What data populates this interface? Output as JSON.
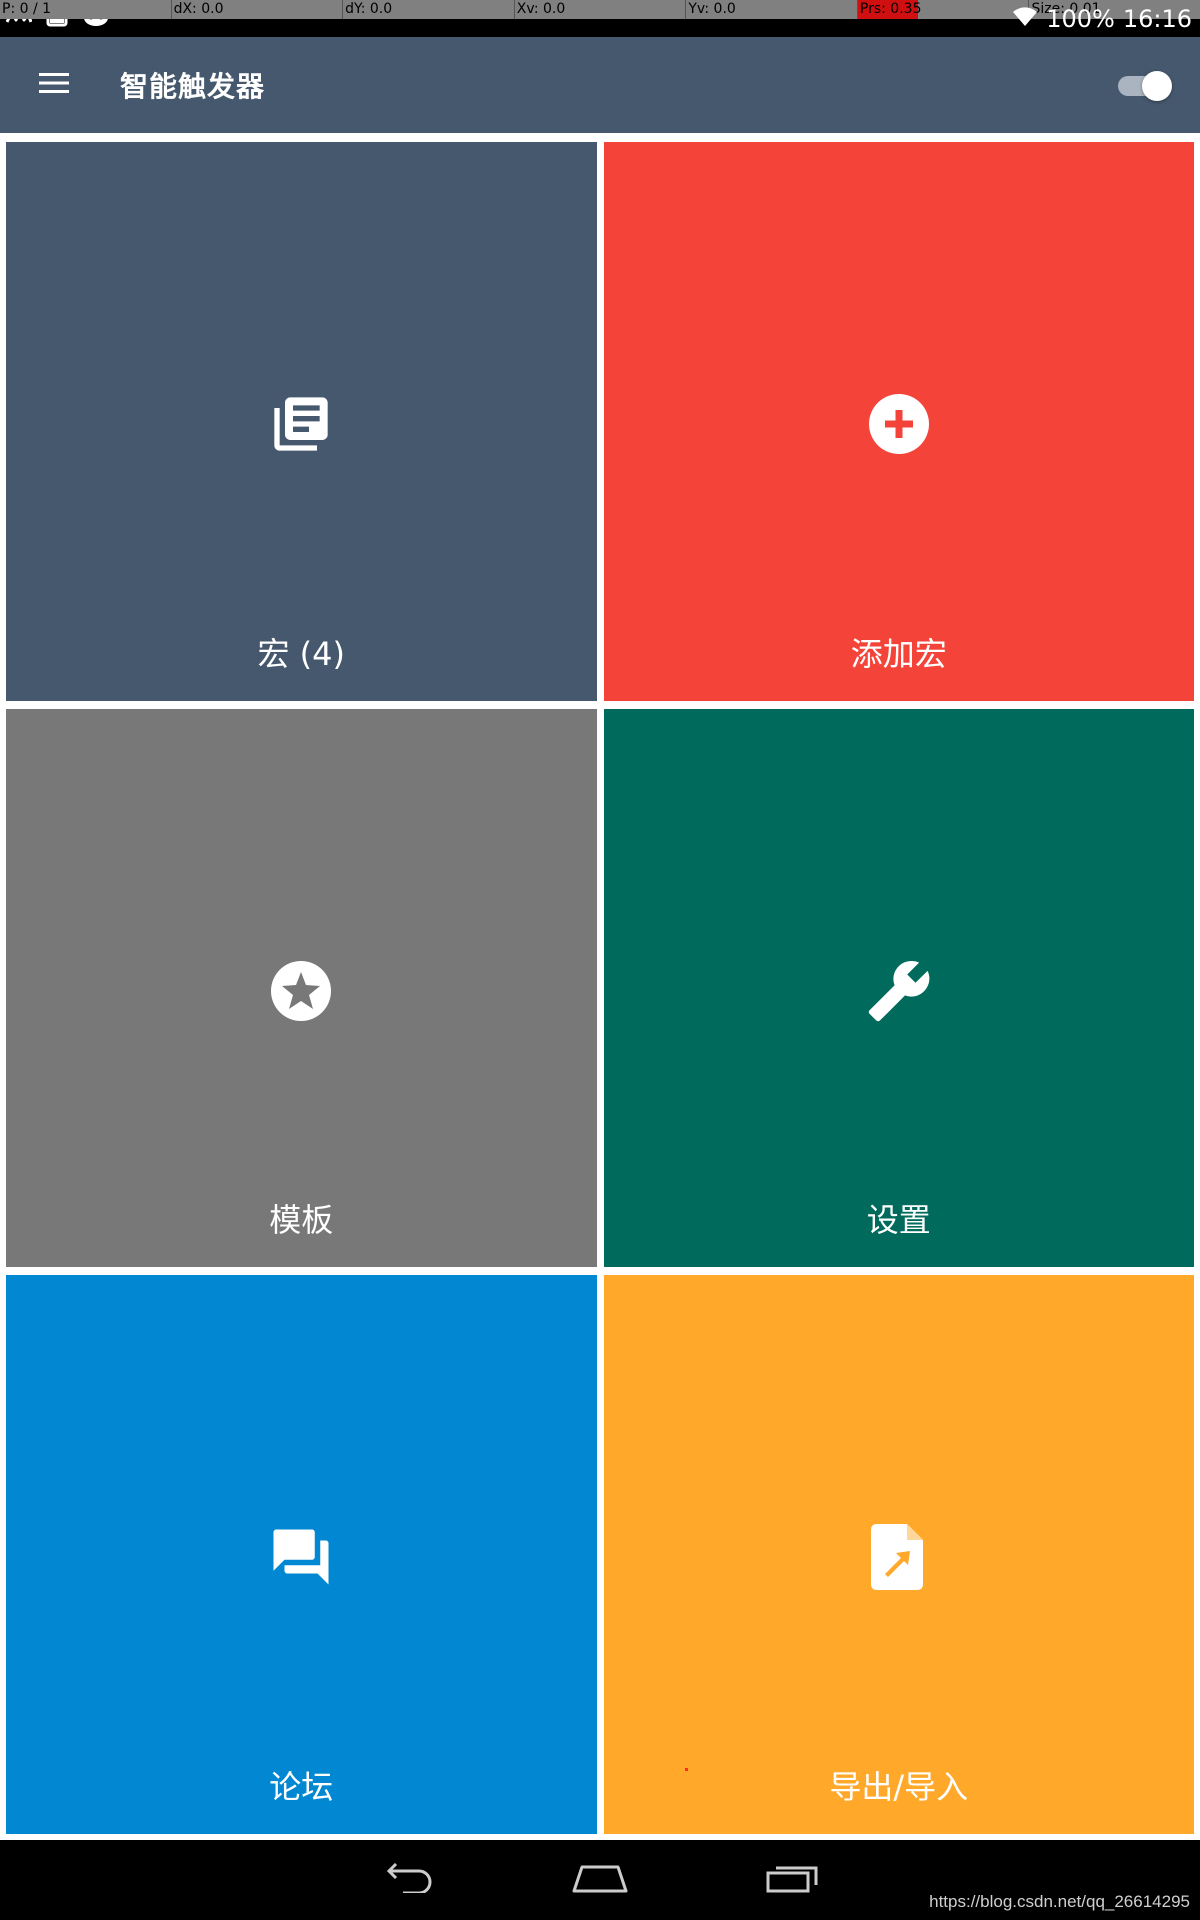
{
  "pointer_location": {
    "p": "P: 0 / 1",
    "dx": "dX: 0.0",
    "dy": "dY: 0.0",
    "xv": "Xv: 0.0",
    "yv": "Yv: 0.0",
    "prs": "Prs: 0.35",
    "prs_level": 0.35,
    "size": "Size: 0.01"
  },
  "status_bar": {
    "left_icons": [
      "activity-wave-icon",
      "tablet-icon",
      "android-bug-icon"
    ],
    "right_icons": [
      "wifi-icon"
    ],
    "battery": "100%",
    "time": "16:16"
  },
  "app_bar": {
    "menu_icon": "menu-icon",
    "title": "智能触发器",
    "toggle_on": true
  },
  "colors": {
    "app_bar": "#46586d",
    "macros": "#46586d",
    "add_macro": "#f44339",
    "templates": "#787878",
    "settings": "#006b5d",
    "forum": "#0288d2",
    "export_import": "#ffa829"
  },
  "tiles": [
    {
      "id": "macros",
      "label": "宏 (4)",
      "icon": "library-books-icon",
      "color": "#46586d"
    },
    {
      "id": "add-macro",
      "label": "添加宏",
      "icon": "add-circle-icon",
      "color": "#f44339"
    },
    {
      "id": "templates",
      "label": "模板",
      "icon": "star-circle-icon",
      "color": "#787878"
    },
    {
      "id": "settings",
      "label": "设置",
      "icon": "wrench-icon",
      "color": "#006b5d"
    },
    {
      "id": "forum",
      "label": "论坛",
      "icon": "forum-icon",
      "color": "#0288d2"
    },
    {
      "id": "export-import",
      "label": "导出/导入",
      "icon": "file-import-icon",
      "color": "#ffa829"
    }
  ],
  "nav_bar": {
    "buttons": [
      "back-icon",
      "home-icon",
      "recent-apps-icon"
    ],
    "watermark": "https://blog.csdn.net/qq_26614295"
  }
}
